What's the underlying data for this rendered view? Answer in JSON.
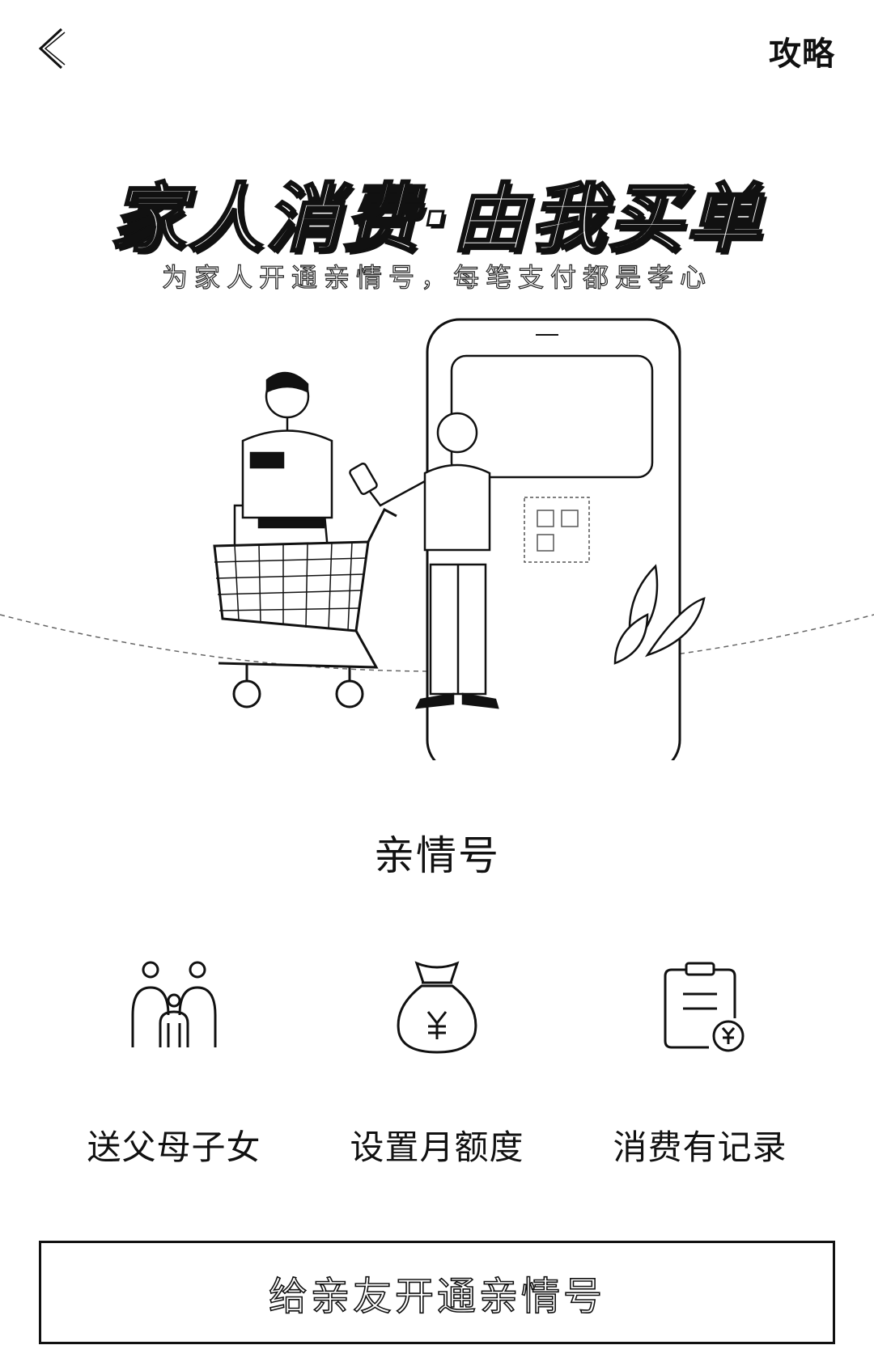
{
  "header": {
    "back_icon": "chevron-left-icon",
    "guide_label": "攻略"
  },
  "hero": {
    "title": "家人消费·由我买单",
    "subtitle": "为家人开通亲情号，每笔支付都是孝心"
  },
  "product": {
    "name": "亲情号"
  },
  "features": [
    {
      "icon": "family-icon",
      "label": "送父母子女"
    },
    {
      "icon": "money-bag-icon",
      "label": "设置月额度"
    },
    {
      "icon": "receipt-record-icon",
      "label": "消费有记录"
    }
  ],
  "cta": {
    "label": "给亲友开通亲情号"
  },
  "colors": {
    "ink": "#111111",
    "background": "#ffffff"
  }
}
